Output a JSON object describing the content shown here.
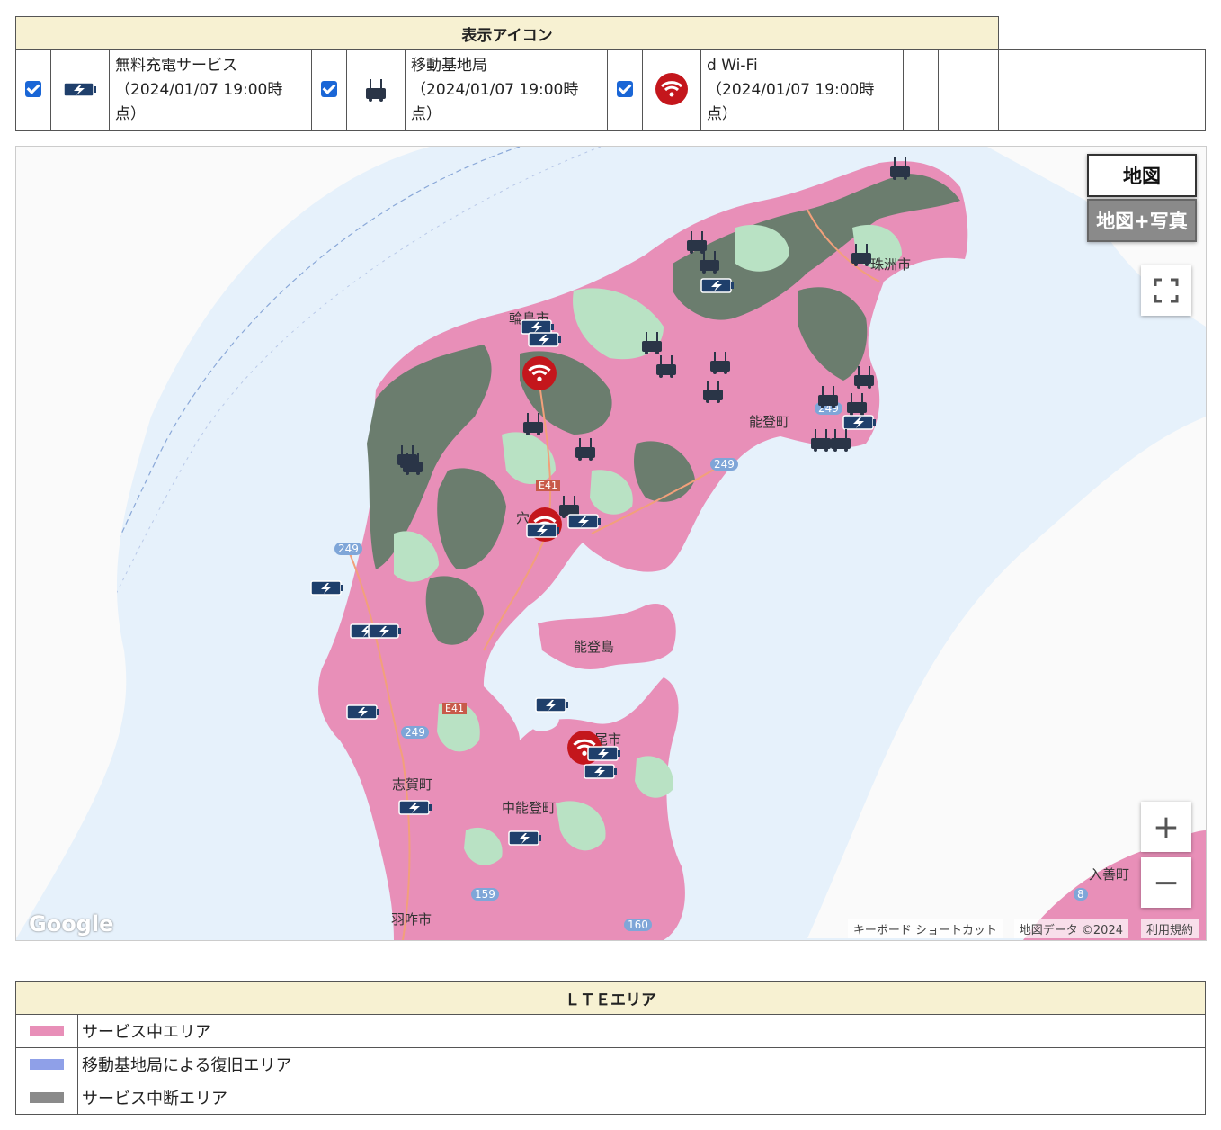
{
  "icon_legend": {
    "title": "表示アイコン",
    "items": [
      {
        "label_line1": "無料充電サービス",
        "label_line2": "（2024/01/07 19:00時",
        "label_line3": "点）",
        "icon": "battery-charge-icon",
        "checked": true
      },
      {
        "label_line1": "移動基地局",
        "label_line2": "（2024/01/07 19:00時",
        "label_line3": "点）",
        "icon": "mobile-base-station-icon",
        "checked": true
      },
      {
        "label_line1": "d Wi-Fi",
        "label_line2": "（2024/01/07 19:00時",
        "label_line3": "点）",
        "icon": "wifi-icon",
        "checked": true
      }
    ]
  },
  "map": {
    "map_type_buttons": {
      "map": "地図",
      "map_photo": "地図+写真"
    },
    "zoom_in": "+",
    "zoom_out": "−",
    "attribution": {
      "google": "Google",
      "shortcuts": "キーボード ショートカット",
      "data": "地図データ ©2024",
      "terms": "利用規約"
    },
    "place_labels": [
      "輪島市",
      "珠洲市",
      "能登町",
      "穴水町",
      "能登島",
      "七尾市",
      "志賀町",
      "中能登町",
      "羽咋市",
      "入善町"
    ],
    "road_labels": [
      "249",
      "249",
      "249",
      "249",
      "E41",
      "E41",
      "159",
      "160",
      "8"
    ],
    "colors": {
      "sea": "#e6f1fb",
      "service": "#e88fb8",
      "outage": "#6b7d6e",
      "lightgreen": "#b9e2c4"
    }
  },
  "lte_legend": {
    "title": "ＬＴＥエリア",
    "items": [
      {
        "label": "サービス中エリア",
        "color": "#e88fb8"
      },
      {
        "label": "移動基地局による復旧エリア",
        "color": "#8fa0e8"
      },
      {
        "label": "サービス中断エリア",
        "color": "#8a8a8a"
      }
    ]
  }
}
